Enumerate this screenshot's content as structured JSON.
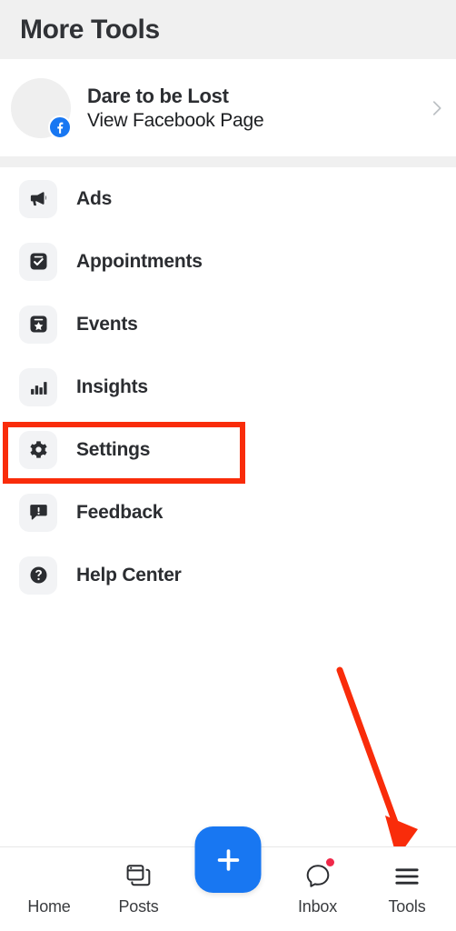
{
  "header": {
    "title": "More Tools"
  },
  "page": {
    "name": "Dare to be Lost",
    "subtitle": "View Facebook Page",
    "avatar_icon": "avatar-placeholder",
    "badge_icon": "facebook-badge-icon",
    "chevron_icon": "chevron-right-icon",
    "avatar_color": "#efefef",
    "badge_color": "#1877f2"
  },
  "menu": {
    "items": [
      {
        "label": "Ads",
        "icon": "megaphone-icon"
      },
      {
        "label": "Appointments",
        "icon": "calendar-check-icon"
      },
      {
        "label": "Events",
        "icon": "calendar-star-icon"
      },
      {
        "label": "Insights",
        "icon": "bar-chart-icon"
      },
      {
        "label": "Settings",
        "icon": "gear-icon"
      },
      {
        "label": "Feedback",
        "icon": "speech-bubble-exclamation-icon"
      },
      {
        "label": "Help Center",
        "icon": "question-circle-icon"
      }
    ]
  },
  "annotations": {
    "highlight_color": "#f92c0a",
    "highlight_target": "Settings",
    "arrow_color": "#f92c0a",
    "arrow_target": "Tools"
  },
  "bottom_nav": {
    "items": [
      {
        "label": "Home",
        "icon": "home-icon",
        "badge": false
      },
      {
        "label": "Posts",
        "icon": "posts-icon",
        "badge": false
      },
      {
        "label": "Inbox",
        "icon": "messenger-icon",
        "badge": true
      },
      {
        "label": "Tools",
        "icon": "hamburger-icon",
        "badge": false
      }
    ],
    "compose": {
      "icon": "plus-icon",
      "color": "#1877f2"
    }
  }
}
